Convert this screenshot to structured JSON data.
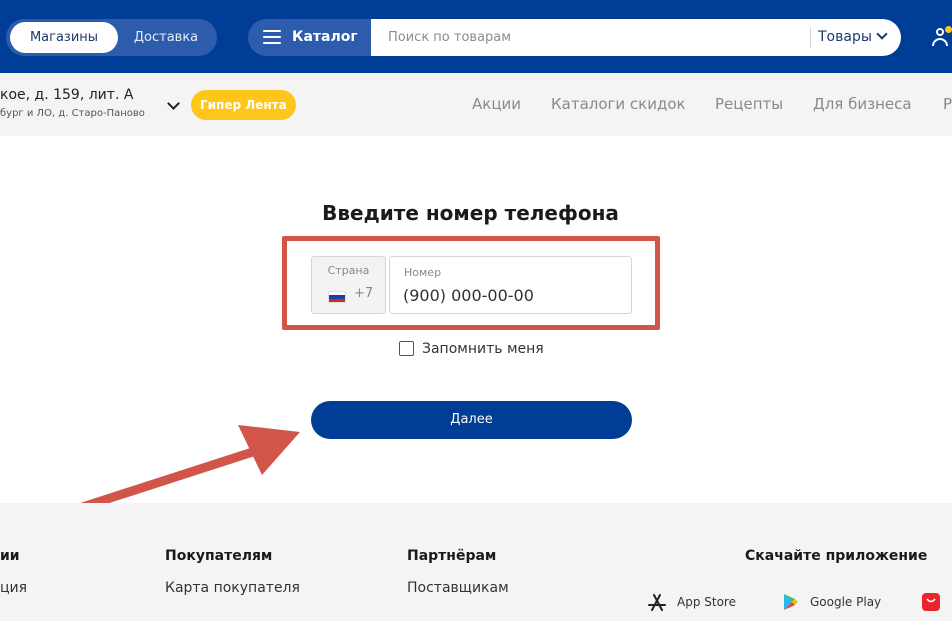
{
  "header": {
    "mode_tabs": [
      {
        "label": "Магазины",
        "active": true
      },
      {
        "label": "Доставка",
        "active": false
      }
    ],
    "catalog_label": "Каталог",
    "search": {
      "placeholder": "Поиск по товарам",
      "scope": "Товары"
    },
    "colors": {
      "brand_blue": "#003d96",
      "accent_yellow": "#ffc61a"
    }
  },
  "subheader": {
    "address_line1": "кое, д. 159, лит. А",
    "address_line2": "бург и ЛО, д. Старо-Паново",
    "store_badge": "Гипер Лента",
    "nav": [
      "Акции",
      "Каталоги скидок",
      "Рецепты",
      "Для бизнеса",
      "Р"
    ]
  },
  "form": {
    "title": "Введите номер телефона",
    "country_label": "Страна",
    "country_code": "+7",
    "country_flag": "russia-flag",
    "phone_label": "Номер",
    "phone_placeholder": "(900) 000-00-00",
    "remember_label": "Запомнить меня",
    "remember_checked": false,
    "submit_label": "Далее",
    "annotation_color": "#d2554a"
  },
  "footer": {
    "col1": {
      "title": "ии",
      "link": "ция"
    },
    "col2": {
      "title": "Покупателям",
      "link": "Карта покупателя"
    },
    "col3": {
      "title": "Партнёрам",
      "link": "Поставщикам"
    },
    "apps": {
      "title": "Скачайте приложение",
      "stores": [
        {
          "label": "App Store",
          "icon": "app-store-icon"
        },
        {
          "label": "Google Play",
          "icon": "google-play-icon"
        }
      ]
    }
  }
}
